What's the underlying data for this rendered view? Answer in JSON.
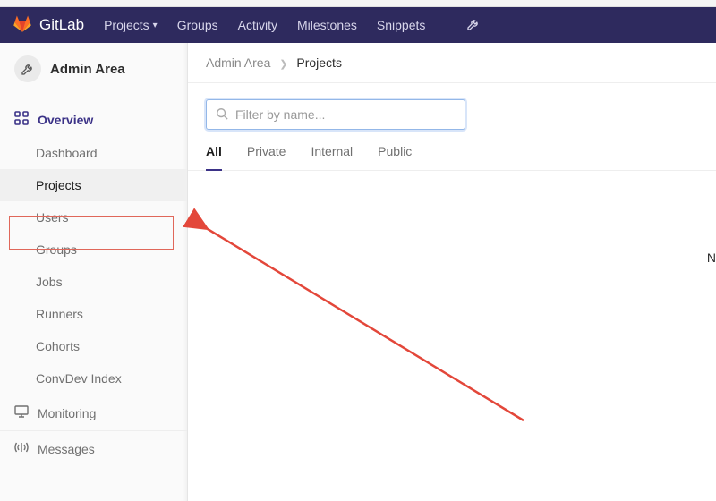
{
  "navbar": {
    "brand": "GitLab",
    "items": [
      {
        "label": "Projects",
        "has_dropdown": true
      },
      {
        "label": "Groups"
      },
      {
        "label": "Activity"
      },
      {
        "label": "Milestones"
      },
      {
        "label": "Snippets"
      }
    ],
    "admin_icon": "wrench-icon"
  },
  "sidebar": {
    "title": "Admin Area",
    "overview": {
      "label": "Overview",
      "items": [
        {
          "label": "Dashboard"
        },
        {
          "label": "Projects",
          "active": true
        },
        {
          "label": "Users"
        },
        {
          "label": "Groups"
        },
        {
          "label": "Jobs"
        },
        {
          "label": "Runners"
        },
        {
          "label": "Cohorts"
        },
        {
          "label": "ConvDev Index"
        }
      ]
    },
    "monitoring": {
      "label": "Monitoring"
    },
    "messages": {
      "label": "Messages"
    }
  },
  "breadcrumb": {
    "root": "Admin Area",
    "current": "Projects"
  },
  "filter": {
    "placeholder": "Filter by name..."
  },
  "tabs": [
    {
      "label": "All",
      "active": true
    },
    {
      "label": "Private"
    },
    {
      "label": "Internal"
    },
    {
      "label": "Public"
    }
  ],
  "edge_letter": "N",
  "annotation": {
    "highlight_target": "sidebar-item-projects",
    "arrow_color": "#e3473a"
  }
}
